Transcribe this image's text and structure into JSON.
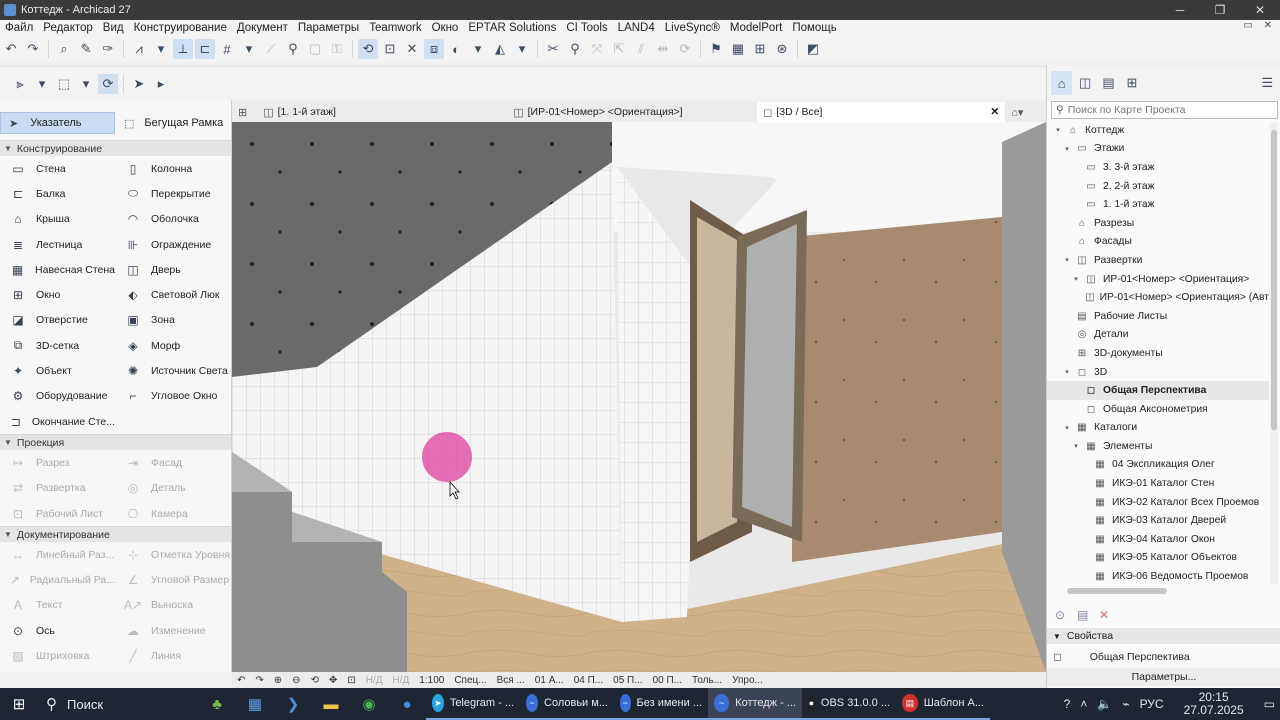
{
  "window": {
    "title": "Коттедж - Archicad 27"
  },
  "menu": [
    "Файл",
    "Редактор",
    "Вид",
    "Конструирование",
    "Документ",
    "Параметры",
    "Teamwork",
    "Окно",
    "EPTAR Solutions",
    "CI Tools",
    "LAND4",
    "LiveSync®",
    "ModelPort",
    "Помощь"
  ],
  "toolbox": {
    "pointer": "Указатель",
    "marquee": "Бегущая Рамка",
    "sections": {
      "design": "Конструирование",
      "viewpoint": "Проекция",
      "document": "Документирование"
    },
    "design_tools": [
      {
        "label": "Стена",
        "icon": "wall-icon",
        "glyph": "▭"
      },
      {
        "label": "Колонна",
        "icon": "column-icon",
        "glyph": "▯"
      },
      {
        "label": "Балка",
        "icon": "beam-icon",
        "glyph": "⊏"
      },
      {
        "label": "Перекрытие",
        "icon": "slab-icon",
        "glyph": "⬭"
      },
      {
        "label": "Крыша",
        "icon": "roof-icon",
        "glyph": "⌂"
      },
      {
        "label": "Оболочка",
        "icon": "shell-icon",
        "glyph": "◠"
      },
      {
        "label": "Лестница",
        "icon": "stair-icon",
        "glyph": "≣"
      },
      {
        "label": "Ограждение",
        "icon": "railing-icon",
        "glyph": "⊪"
      },
      {
        "label": "Навесная Стена",
        "icon": "curtain-wall-icon",
        "glyph": "▦"
      },
      {
        "label": "Дверь",
        "icon": "door-icon",
        "glyph": "◫"
      },
      {
        "label": "Окно",
        "icon": "window-icon",
        "glyph": "⊞"
      },
      {
        "label": "Световой Люк",
        "icon": "skylight-icon",
        "glyph": "⬖"
      },
      {
        "label": "Отверстие",
        "icon": "opening-icon",
        "glyph": "◪"
      },
      {
        "label": "Зона",
        "icon": "zone-icon",
        "glyph": "▣"
      },
      {
        "label": "3D-сетка",
        "icon": "mesh-icon",
        "glyph": "⧉"
      },
      {
        "label": "Морф",
        "icon": "morph-icon",
        "glyph": "◈"
      },
      {
        "label": "Объект",
        "icon": "object-icon",
        "glyph": "✦"
      },
      {
        "label": "Источник Света",
        "icon": "lamp-icon",
        "glyph": "✺"
      },
      {
        "label": "Оборудование",
        "icon": "equipment-icon",
        "glyph": "⚙"
      },
      {
        "label": "Угловое Окно",
        "icon": "corner-window-icon",
        "glyph": "⌐"
      },
      {
        "label": "Окончание Сте...",
        "icon": "wall-end-icon",
        "glyph": "⊐"
      }
    ],
    "viewpoint_tools": [
      {
        "label": "Разрез",
        "icon": "section-icon",
        "glyph": "↦"
      },
      {
        "label": "Фасад",
        "icon": "elevation-icon",
        "glyph": "⇥"
      },
      {
        "label": "Развертка",
        "icon": "interior-elevation-icon",
        "glyph": "⇄"
      },
      {
        "label": "Деталь",
        "icon": "detail-icon",
        "glyph": "◎"
      },
      {
        "label": "Рабочий Лист",
        "icon": "worksheet-icon",
        "glyph": "⊡"
      },
      {
        "label": "Камера",
        "icon": "camera-icon",
        "glyph": "⎔"
      }
    ],
    "document_tools": [
      {
        "label": "Линейный Раз...",
        "icon": "dimension-icon",
        "glyph": "↔",
        "disabled": true
      },
      {
        "label": "Отметка Уровня",
        "icon": "level-dimension-icon",
        "glyph": "⊹",
        "disabled": true
      },
      {
        "label": "Радиальный Ра...",
        "icon": "radial-dimension-icon",
        "glyph": "↗",
        "disabled": true
      },
      {
        "label": "Угловой Размер",
        "icon": "angle-dimension-icon",
        "glyph": "∠",
        "disabled": true
      },
      {
        "label": "Текст",
        "icon": "text-icon",
        "glyph": "A",
        "disabled": true
      },
      {
        "label": "Выноска",
        "icon": "label-icon",
        "glyph": "A↗",
        "disabled": true
      },
      {
        "label": "Ось",
        "icon": "grid-axis-icon",
        "glyph": "⊙",
        "disabled": false
      },
      {
        "label": "Изменение",
        "icon": "change-icon",
        "glyph": "☁",
        "disabled": true
      },
      {
        "label": "Штриховка",
        "icon": "fill-icon",
        "glyph": "▨",
        "disabled": true
      },
      {
        "label": "Линия",
        "icon": "line-icon",
        "glyph": "╱",
        "disabled": true
      }
    ]
  },
  "tabs": [
    {
      "label": "[1. 1-й этаж]",
      "icon": "floor-plan-icon"
    },
    {
      "label": "[ИР-01<Номер> <Ориентация>]",
      "icon": "interior-elevation-icon"
    },
    {
      "label": "[3D / Все]",
      "icon": "3d-icon"
    }
  ],
  "viewstatus": {
    "nd1": "Н/Д",
    "nd2": "Н/Д",
    "scale": "1:100",
    "layers": "Спец...",
    "model": "Вся ...",
    "pen": "01 А...",
    "override": "04 П...",
    "mvo": "05 П...",
    "dim": "00 П...",
    "only": "Толь...",
    "simplify": "Упро..."
  },
  "navigator": {
    "search_placeholder": "Поиск по Карте Проекта",
    "tree": [
      {
        "label": "Коттедж",
        "depth": 0,
        "tw": "▾",
        "icon": "project-icon",
        "glyph": "⌂"
      },
      {
        "label": "Этажи",
        "depth": 1,
        "tw": "▾",
        "icon": "stories-icon",
        "glyph": "▭"
      },
      {
        "label": "3. 3-й этаж",
        "depth": 2,
        "tw": "",
        "icon": "story-icon",
        "glyph": "▭"
      },
      {
        "label": "2. 2-й этаж",
        "depth": 2,
        "tw": "",
        "icon": "story-icon",
        "glyph": "▭"
      },
      {
        "label": "1. 1-й этаж",
        "depth": 2,
        "tw": "",
        "icon": "story-icon",
        "glyph": "▭"
      },
      {
        "label": "Разрезы",
        "depth": 1,
        "tw": "",
        "icon": "sections-icon",
        "glyph": "⌂"
      },
      {
        "label": "Фасады",
        "depth": 1,
        "tw": "",
        "icon": "elevations-icon",
        "glyph": "⌂"
      },
      {
        "label": "Развертки",
        "depth": 1,
        "tw": "▾",
        "icon": "interior-elevations-icon",
        "glyph": "◫"
      },
      {
        "label": "ИР-01<Номер> <Ориентация>",
        "depth": 2,
        "tw": "▾",
        "icon": "ie-group-icon",
        "glyph": "◫"
      },
      {
        "label": "ИР-01<Номер> <Ориентация> (Авт",
        "depth": 3,
        "tw": "",
        "icon": "ie-view-icon",
        "glyph": "◫"
      },
      {
        "label": "Рабочие Листы",
        "depth": 1,
        "tw": "",
        "icon": "worksheets-icon",
        "glyph": "▤"
      },
      {
        "label": "Детали",
        "depth": 1,
        "tw": "",
        "icon": "details-icon",
        "glyph": "◎"
      },
      {
        "label": "3D-документы",
        "depth": 1,
        "tw": "",
        "icon": "3d-documents-icon",
        "glyph": "⊞"
      },
      {
        "label": "3D",
        "depth": 1,
        "tw": "▾",
        "icon": "3d-folder-icon",
        "glyph": "◻"
      },
      {
        "label": "Общая Перспектива",
        "depth": 2,
        "tw": "",
        "icon": "perspective-icon",
        "glyph": "◻",
        "selected": true
      },
      {
        "label": "Общая Аксонометрия",
        "depth": 2,
        "tw": "",
        "icon": "axonometry-icon",
        "glyph": "◻"
      },
      {
        "label": "Каталоги",
        "depth": 1,
        "tw": "▾",
        "icon": "schedules-icon",
        "glyph": "▦"
      },
      {
        "label": "Элементы",
        "depth": 2,
        "tw": "▾",
        "icon": "elements-icon",
        "glyph": "▦"
      },
      {
        "label": "04 Экспликация Олег",
        "depth": 3,
        "tw": "",
        "icon": "schedule-icon",
        "glyph": "▦"
      },
      {
        "label": "ИКЭ-01 Каталог Стен",
        "depth": 3,
        "tw": "",
        "icon": "schedule-icon",
        "glyph": "▦"
      },
      {
        "label": "ИКЭ-02 Каталог Всех Проемов",
        "depth": 3,
        "tw": "",
        "icon": "schedule-icon",
        "glyph": "▦"
      },
      {
        "label": "ИКЭ-03 Каталог Дверей",
        "depth": 3,
        "tw": "",
        "icon": "schedule-icon",
        "glyph": "▦"
      },
      {
        "label": "ИКЭ-04 Каталог Окон",
        "depth": 3,
        "tw": "",
        "icon": "schedule-icon",
        "glyph": "▦"
      },
      {
        "label": "ИКЭ-05 Каталог Объектов",
        "depth": 3,
        "tw": "",
        "icon": "schedule-icon",
        "glyph": "▦"
      },
      {
        "label": "ИКЭ-06 Ведомость Проемов",
        "depth": 3,
        "tw": "",
        "icon": "schedule-icon",
        "glyph": "▦"
      }
    ],
    "properties_title": "Свойства",
    "properties_name": "Общая Перспектива",
    "parameters_button": "Параметры..."
  },
  "taskbar": {
    "search": "Поиск",
    "apps": [
      {
        "label": "Telegram - ...",
        "color": "#2aa3df",
        "glyph": "➤"
      },
      {
        "label": "Соловьи м...",
        "color": "#3a6fd8",
        "glyph": "~"
      },
      {
        "label": "Без имени ...",
        "color": "#3a6fd8",
        "glyph": "~"
      },
      {
        "label": "Коттедж - ...",
        "color": "#3a6fd8",
        "glyph": "~",
        "active": true
      },
      {
        "label": "OBS 31.0.0 ...",
        "color": "#222",
        "glyph": "●"
      },
      {
        "label": "Шаблон А...",
        "color": "#d0312d",
        "glyph": "▤"
      }
    ],
    "lang": "РУС",
    "time": "20:15",
    "date": "27.07.2025"
  },
  "colors": {
    "accent": "#c9dcf1",
    "cursor_highlight": "#e040a0"
  }
}
